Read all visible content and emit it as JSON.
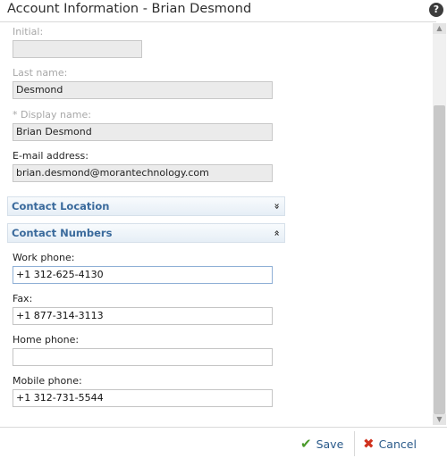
{
  "window": {
    "title": "Account Information - Brian Desmond",
    "help_icon": "?"
  },
  "fields": {
    "initial": {
      "label": "Initial:",
      "value": ""
    },
    "last_name": {
      "label": "Last name:",
      "value": "Desmond"
    },
    "display_name": {
      "label": "* Display name:",
      "value": "Brian Desmond"
    },
    "email": {
      "label": "E-mail address:",
      "value": "brian.desmond@morantechnology.com"
    }
  },
  "sections": {
    "contact_location": {
      "label": "Contact Location",
      "chevron": "»",
      "state": "collapsed"
    },
    "contact_numbers": {
      "label": "Contact Numbers",
      "chevron": "«",
      "state": "expanded"
    }
  },
  "phones": {
    "work": {
      "label": "Work phone:",
      "value": "+1 312-625-4130"
    },
    "fax": {
      "label": "Fax:",
      "value": "+1 877-314-3113"
    },
    "home": {
      "label": "Home phone:",
      "value": ""
    },
    "mobile": {
      "label": "Mobile phone:",
      "value": "+1 312-731-5544"
    }
  },
  "footer": {
    "save_label": "Save",
    "save_icon": "✔",
    "cancel_label": "Cancel",
    "cancel_icon": "✖"
  },
  "icons": {
    "help": "help-icon",
    "expand": "chevron-double-down-icon",
    "collapse": "chevron-double-up-icon",
    "save": "checkmark-icon",
    "cancel": "x-icon"
  },
  "colors": {
    "section_header_text": "#3a6a9c",
    "save_icon": "#4a9a2a",
    "cancel_icon": "#d0321e",
    "readonly_field_bg": "#ebebeb"
  }
}
